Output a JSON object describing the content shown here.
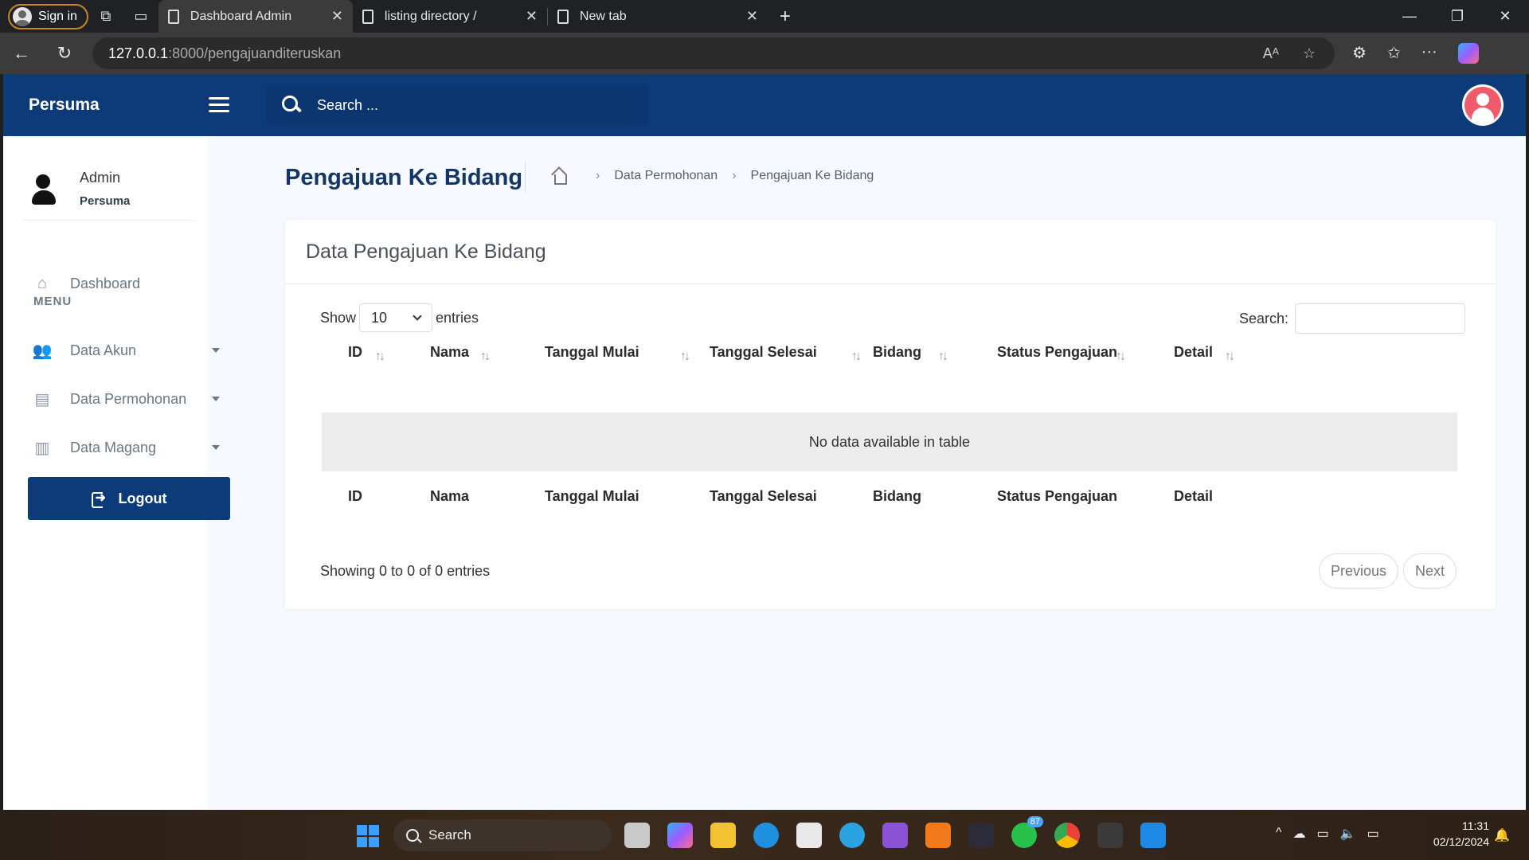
{
  "browser": {
    "signin_label": "Sign in",
    "tabs": [
      {
        "title": "Dashboard Admin"
      },
      {
        "title": "listing directory /"
      },
      {
        "title": "New tab"
      }
    ],
    "url_host": "127.0.0.1",
    "url_path": ":8000/pengajuanditeruskan"
  },
  "app": {
    "brand": "Persuma",
    "search_placeholder": "Search ...",
    "profile": {
      "name": "Admin",
      "role": "Persuma"
    },
    "sidebar": {
      "dashboard": "Dashboard",
      "menu_title": "MENU",
      "items": [
        {
          "label": "Data Akun"
        },
        {
          "label": "Data Permohonan"
        },
        {
          "label": "Data Magang"
        }
      ],
      "logout": "Logout"
    },
    "page_title": "Pengajuan Ke Bidang",
    "breadcrumb": [
      "Data Permohonan",
      "Pengajuan Ke Bidang"
    ],
    "card_title": "Data Pengajuan Ke Bidang",
    "table": {
      "show_label": "Show",
      "entries_value": "10",
      "entries_label": "entries",
      "search_label": "Search:",
      "columns": [
        "ID",
        "Nama",
        "Tanggal Mulai",
        "Tanggal Selesai",
        "Bidang",
        "Status Pengajuan",
        "Detail"
      ],
      "empty_message": "No data available in table",
      "info": "Showing 0 to 0 of 0 entries",
      "previous": "Previous",
      "next": "Next"
    }
  },
  "taskbar": {
    "search_label": "Search",
    "whatsapp_badge": "87",
    "time": "11:31",
    "date": "02/12/2024"
  }
}
